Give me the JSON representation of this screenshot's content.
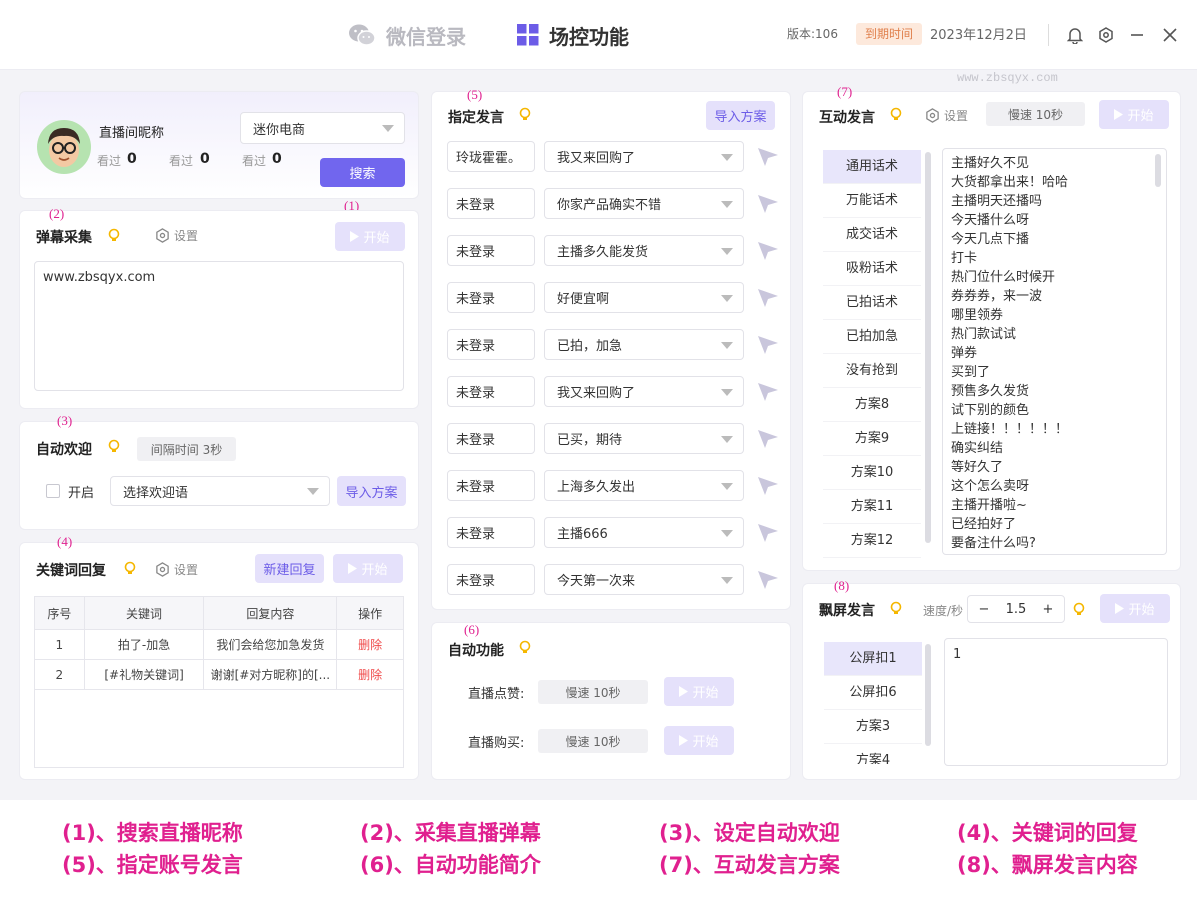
{
  "titlebar": {
    "tabs": [
      {
        "label": "微信登录"
      },
      {
        "label": "场控功能"
      }
    ],
    "version": "版本:106",
    "expire_label": "到期时间",
    "expire_date": "2023年12月2日"
  },
  "watermark": "www.zbsqyx.com",
  "profile": {
    "nickname": "直播间昵称",
    "stats": [
      {
        "label": "看过",
        "value": "0"
      },
      {
        "label": "看过",
        "value": "0"
      },
      {
        "label": "看过",
        "value": "0"
      }
    ],
    "room_select": "迷你电商",
    "search_label": "搜索"
  },
  "markers": [
    "(1)",
    "(2)",
    "(3)",
    "(4)",
    "(5)",
    "(6)",
    "(7)",
    "(8)"
  ],
  "danmu": {
    "title": "弹幕采集",
    "settings_label": "设置",
    "start_label": "开始",
    "content": "www.zbsqyx.com"
  },
  "welcome": {
    "title": "自动欢迎",
    "interval": "间隔时间 3秒",
    "enable_label": "开启",
    "select_placeholder": "选择欢迎语",
    "import_label": "导入方案"
  },
  "keyword": {
    "title": "关键词回复",
    "settings_label": "设置",
    "new_label": "新建回复",
    "start_label": "开始",
    "columns": [
      "序号",
      "关键词",
      "回复内容",
      "操作"
    ],
    "rows": [
      {
        "index": "1",
        "keyword": "拍了-加急",
        "reply": "我们会给您加急发货",
        "action": "删除"
      },
      {
        "index": "2",
        "keyword": "[#礼物关键词]",
        "reply": "谢谢[#对方昵称]的[...",
        "action": "删除"
      }
    ]
  },
  "assigned": {
    "title": "指定发言",
    "import_label": "导入方案",
    "rows": [
      {
        "account": "玲珑霍霍。",
        "phrase": "我又来回购了"
      },
      {
        "account": "未登录",
        "phrase": "你家产品确实不错"
      },
      {
        "account": "未登录",
        "phrase": "主播多久能发货"
      },
      {
        "account": "未登录",
        "phrase": "好便宜啊"
      },
      {
        "account": "未登录",
        "phrase": "已拍，加急"
      },
      {
        "account": "未登录",
        "phrase": "我又来回购了"
      },
      {
        "account": "未登录",
        "phrase": "已买，期待"
      },
      {
        "account": "未登录",
        "phrase": "上海多久发出"
      },
      {
        "account": "未登录",
        "phrase": "主播666"
      },
      {
        "account": "未登录",
        "phrase": "今天第一次来"
      }
    ]
  },
  "auto": {
    "title": "自动功能",
    "items": [
      {
        "label": "直播点赞:",
        "speed": "慢速 10秒",
        "start_label": "开始"
      },
      {
        "label": "直播购买:",
        "speed": "慢速 10秒",
        "start_label": "开始"
      }
    ]
  },
  "interact": {
    "title": "互动发言",
    "settings_label": "设置",
    "speed": "慢速 10秒",
    "start_label": "开始",
    "categories": [
      "通用话术",
      "万能话术",
      "成交话术",
      "吸粉话术",
      "已拍话术",
      "已拍加急",
      "没有抢到",
      "方案8",
      "方案9",
      "方案10",
      "方案11",
      "方案12"
    ],
    "phrases": [
      "主播好久不见",
      "大货都拿出来！哈哈",
      "主播明天还播吗",
      "今天播什么呀",
      "今天几点下播",
      "打卡",
      "热门位什么时候开",
      "券券券，来一波",
      "哪里领券",
      "热门款试试",
      "弹券",
      "买到了",
      "预售多久发货",
      "试下别的颜色",
      "上链接！！！！！！",
      "确实纠结",
      "等好久了",
      "这个怎么卖呀",
      "主播开播啦~",
      "已经拍好了",
      "要备注什么吗?"
    ]
  },
  "float": {
    "title": "飘屏发言",
    "speed_label": "速度/秒",
    "speed_value": "1.5",
    "start_label": "开始",
    "categories": [
      "公屏扣1",
      "公屏扣6",
      "方案3",
      "方案4"
    ],
    "content": "1"
  },
  "captions": [
    "(1)、搜索直播昵称",
    "(2)、采集直播弹幕",
    "(3)、设定自动欢迎",
    "(4)、关键词的回复",
    "(5)、指定账号发言",
    "(6)、自动功能简介",
    "(7)、互动发言方案",
    "(8)、飘屏发言内容"
  ],
  "colors": {
    "accent": "#7166ee",
    "accent_light": "#e5e1fb",
    "marker": "#e0208f",
    "delete": "#f04a4a"
  }
}
